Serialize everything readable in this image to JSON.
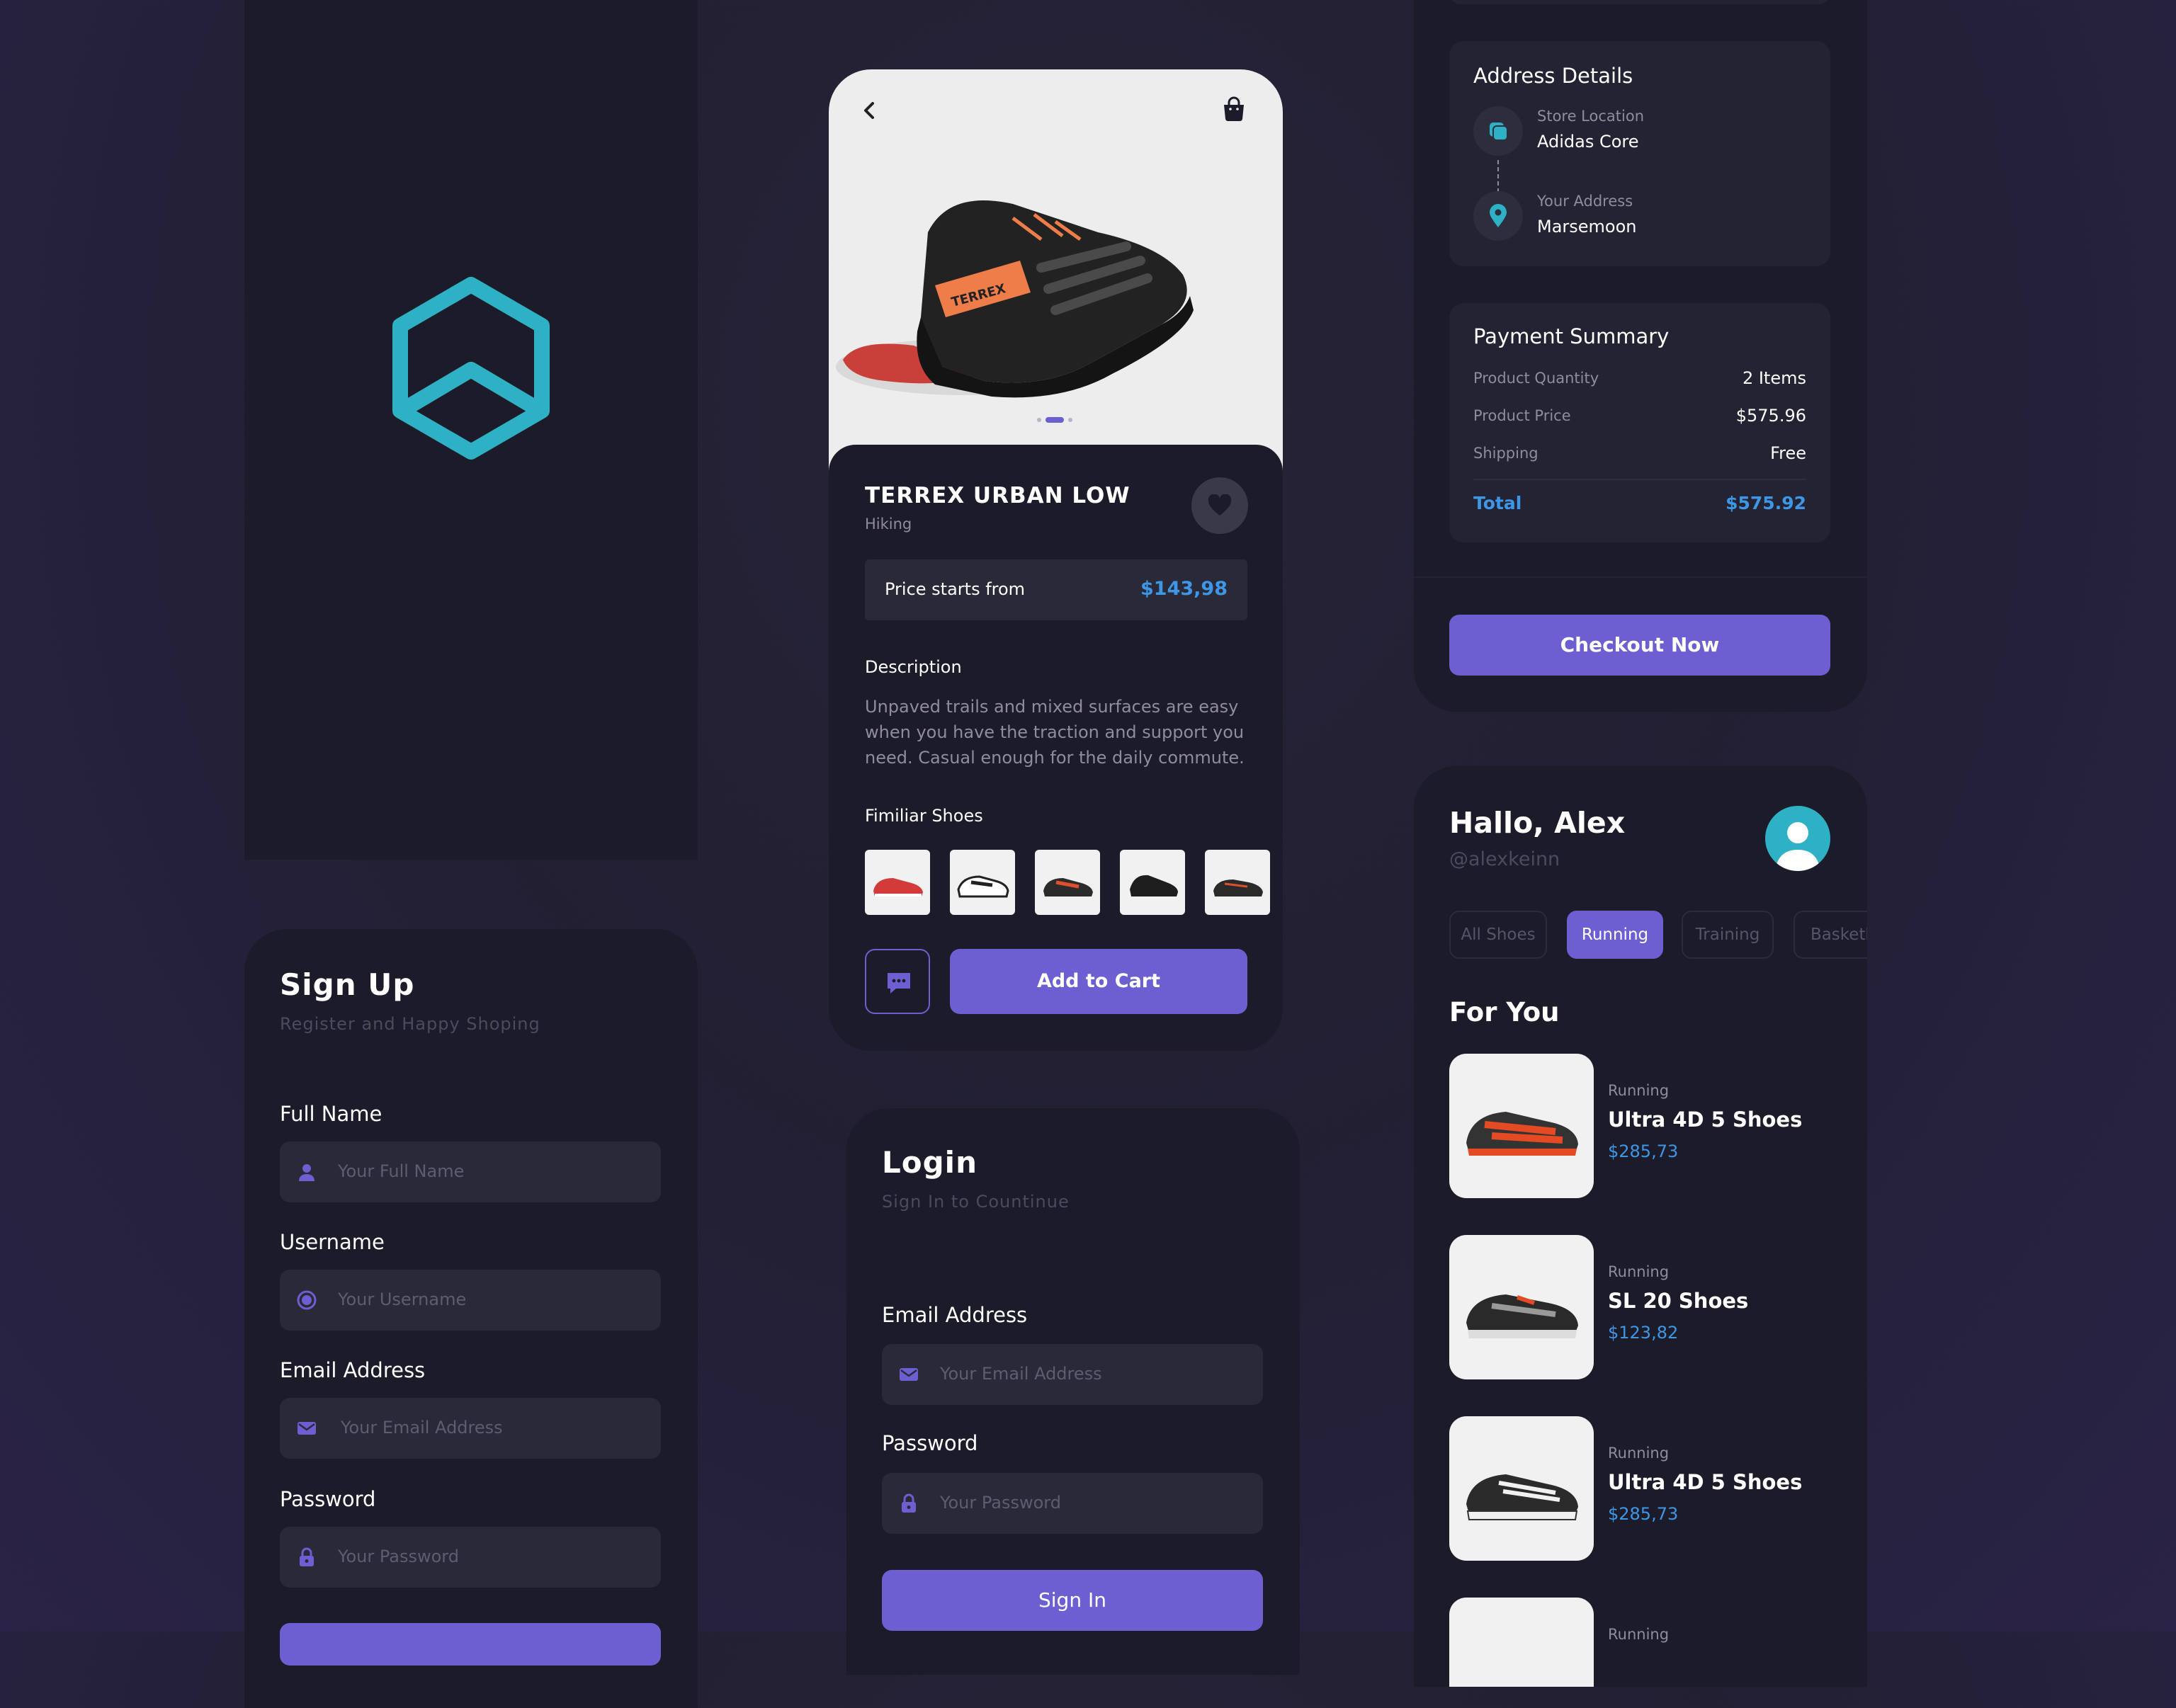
{
  "colors": {
    "background": "#221f33",
    "panel": "#1c1b29",
    "card": "#232333",
    "accent": "#6c5fd1",
    "price_blue": "#3e97e6",
    "logo_teal": "#2fb1c5"
  },
  "splash": {
    "logo_icon": "hexagon-logo-icon"
  },
  "signup": {
    "title": "Sign Up",
    "subtitle": "Register and Happy Shoping",
    "fields": [
      {
        "label": "Full Name",
        "placeholder": "Your Full Name",
        "icon": "user-icon"
      },
      {
        "label": "Username",
        "placeholder": "Your Username",
        "icon": "target-icon"
      },
      {
        "label": "Email Address",
        "placeholder": "Your Email Address",
        "icon": "mail-icon"
      },
      {
        "label": "Password",
        "placeholder": "Your Password",
        "icon": "lock-icon"
      }
    ]
  },
  "product": {
    "name": "TERREX URBAN LOW",
    "category": "Hiking",
    "price_label": "Price starts from",
    "price": "$143,98",
    "description_title": "Description",
    "description": "Unpaved trails and mixed surfaces are easy when you have the traction and support you need. Casual enough for the daily commute.",
    "similar_title": "Fimiliar Shoes",
    "add_to_cart": "Add to Cart",
    "carousel": {
      "count": 3,
      "active": 1
    }
  },
  "login": {
    "title": "Login",
    "subtitle": "Sign In to Countinue",
    "email_label": "Email Address",
    "email_placeholder": "Your Email Address",
    "password_label": "Password",
    "password_placeholder": "Your Password",
    "sign_in": "Sign In"
  },
  "checkout": {
    "address_title": "Address Details",
    "store_label": "Store Location",
    "store_value": "Adidas Core",
    "your_address_label": "Your Address",
    "your_address_value": "Marsemoon",
    "payment_title": "Payment Summary",
    "rows": [
      {
        "label": "Product Quantity",
        "value": "2 Items"
      },
      {
        "label": "Product Price",
        "value": "$575.96"
      },
      {
        "label": "Shipping",
        "value": "Free"
      }
    ],
    "total_label": "Total",
    "total_value": "$575.92",
    "checkout_button": "Checkout Now"
  },
  "home": {
    "greeting": "Hallo, Alex",
    "handle": "@alexkeinn",
    "chips": [
      {
        "label": "All Shoes",
        "active": false
      },
      {
        "label": "Running",
        "active": true
      },
      {
        "label": "Training",
        "active": false
      },
      {
        "label": "Basketb",
        "active": false
      }
    ],
    "section_title": "For You",
    "products": [
      {
        "category": "Running",
        "name": "Ultra 4D 5 Shoes",
        "price": "$285,73"
      },
      {
        "category": "Running",
        "name": "SL 20 Shoes",
        "price": "$123,82"
      },
      {
        "category": "Running",
        "name": "Ultra 4D 5 Shoes",
        "price": "$285,73"
      },
      {
        "category": "Running",
        "name": "",
        "price": ""
      }
    ]
  }
}
